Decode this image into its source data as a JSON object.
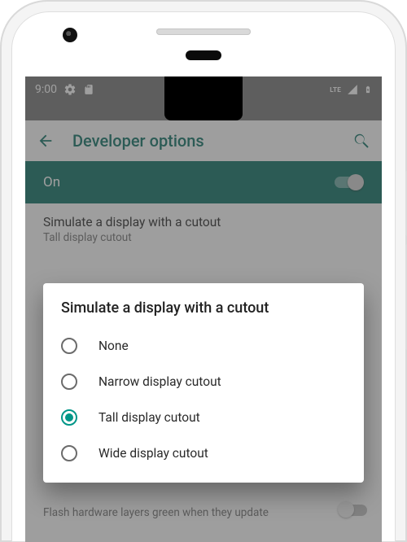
{
  "status_bar": {
    "time": "9:00",
    "lte_label": "LTE"
  },
  "app_bar": {
    "title": "Developer options"
  },
  "master_toggle": {
    "label": "On",
    "enabled": true
  },
  "visible_pref": {
    "title": "Simulate a display with a cutout",
    "subtitle": "Tall display cutout"
  },
  "peek_pref": {
    "title": "Flash hardware layers green when they update"
  },
  "dialog": {
    "title": "Simulate a display with a cutout",
    "options": [
      {
        "label": "None",
        "selected": false
      },
      {
        "label": "Narrow display cutout",
        "selected": false
      },
      {
        "label": "Tall display cutout",
        "selected": true
      },
      {
        "label": "Wide display cutout",
        "selected": false
      }
    ]
  },
  "colors": {
    "accent_teal": "#009688",
    "toolbar_teal": "#00695c",
    "scrim_gray": "rgba(80,80,80,0.55)"
  }
}
